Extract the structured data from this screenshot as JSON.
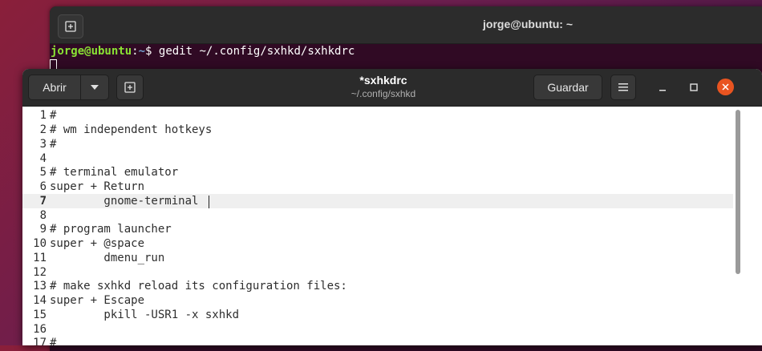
{
  "terminal": {
    "title": "jorge@ubuntu: ~",
    "prompt_user": "jorge@ubuntu",
    "prompt_sep": ":",
    "prompt_path": "~",
    "prompt_symbol": "$ ",
    "command": "gedit ~/.config/sxhkd/sxhkdrc"
  },
  "gedit": {
    "open_label": "Abrir",
    "save_label": "Guardar",
    "title": "*sxhkdrc",
    "subtitle": "~/.config/sxhkd",
    "accent_close_color": "#e95420"
  },
  "editor": {
    "current_line": 7,
    "lines": [
      {
        "n": "1",
        "text": "#"
      },
      {
        "n": "2",
        "text": "# wm independent hotkeys"
      },
      {
        "n": "3",
        "text": "#"
      },
      {
        "n": "4",
        "text": ""
      },
      {
        "n": "5",
        "text": "# terminal emulator"
      },
      {
        "n": "6",
        "text": "super + Return"
      },
      {
        "n": "7",
        "text": "        gnome-terminal"
      },
      {
        "n": "8",
        "text": ""
      },
      {
        "n": "9",
        "text": "# program launcher"
      },
      {
        "n": "10",
        "text": "super + @space"
      },
      {
        "n": "11",
        "text": "        dmenu_run"
      },
      {
        "n": "12",
        "text": ""
      },
      {
        "n": "13",
        "text": "# make sxhkd reload its configuration files:"
      },
      {
        "n": "14",
        "text": "super + Escape"
      },
      {
        "n": "15",
        "text": "        pkill -USR1 -x sxhkd"
      },
      {
        "n": "16",
        "text": ""
      },
      {
        "n": "17",
        "text": "#"
      }
    ]
  }
}
